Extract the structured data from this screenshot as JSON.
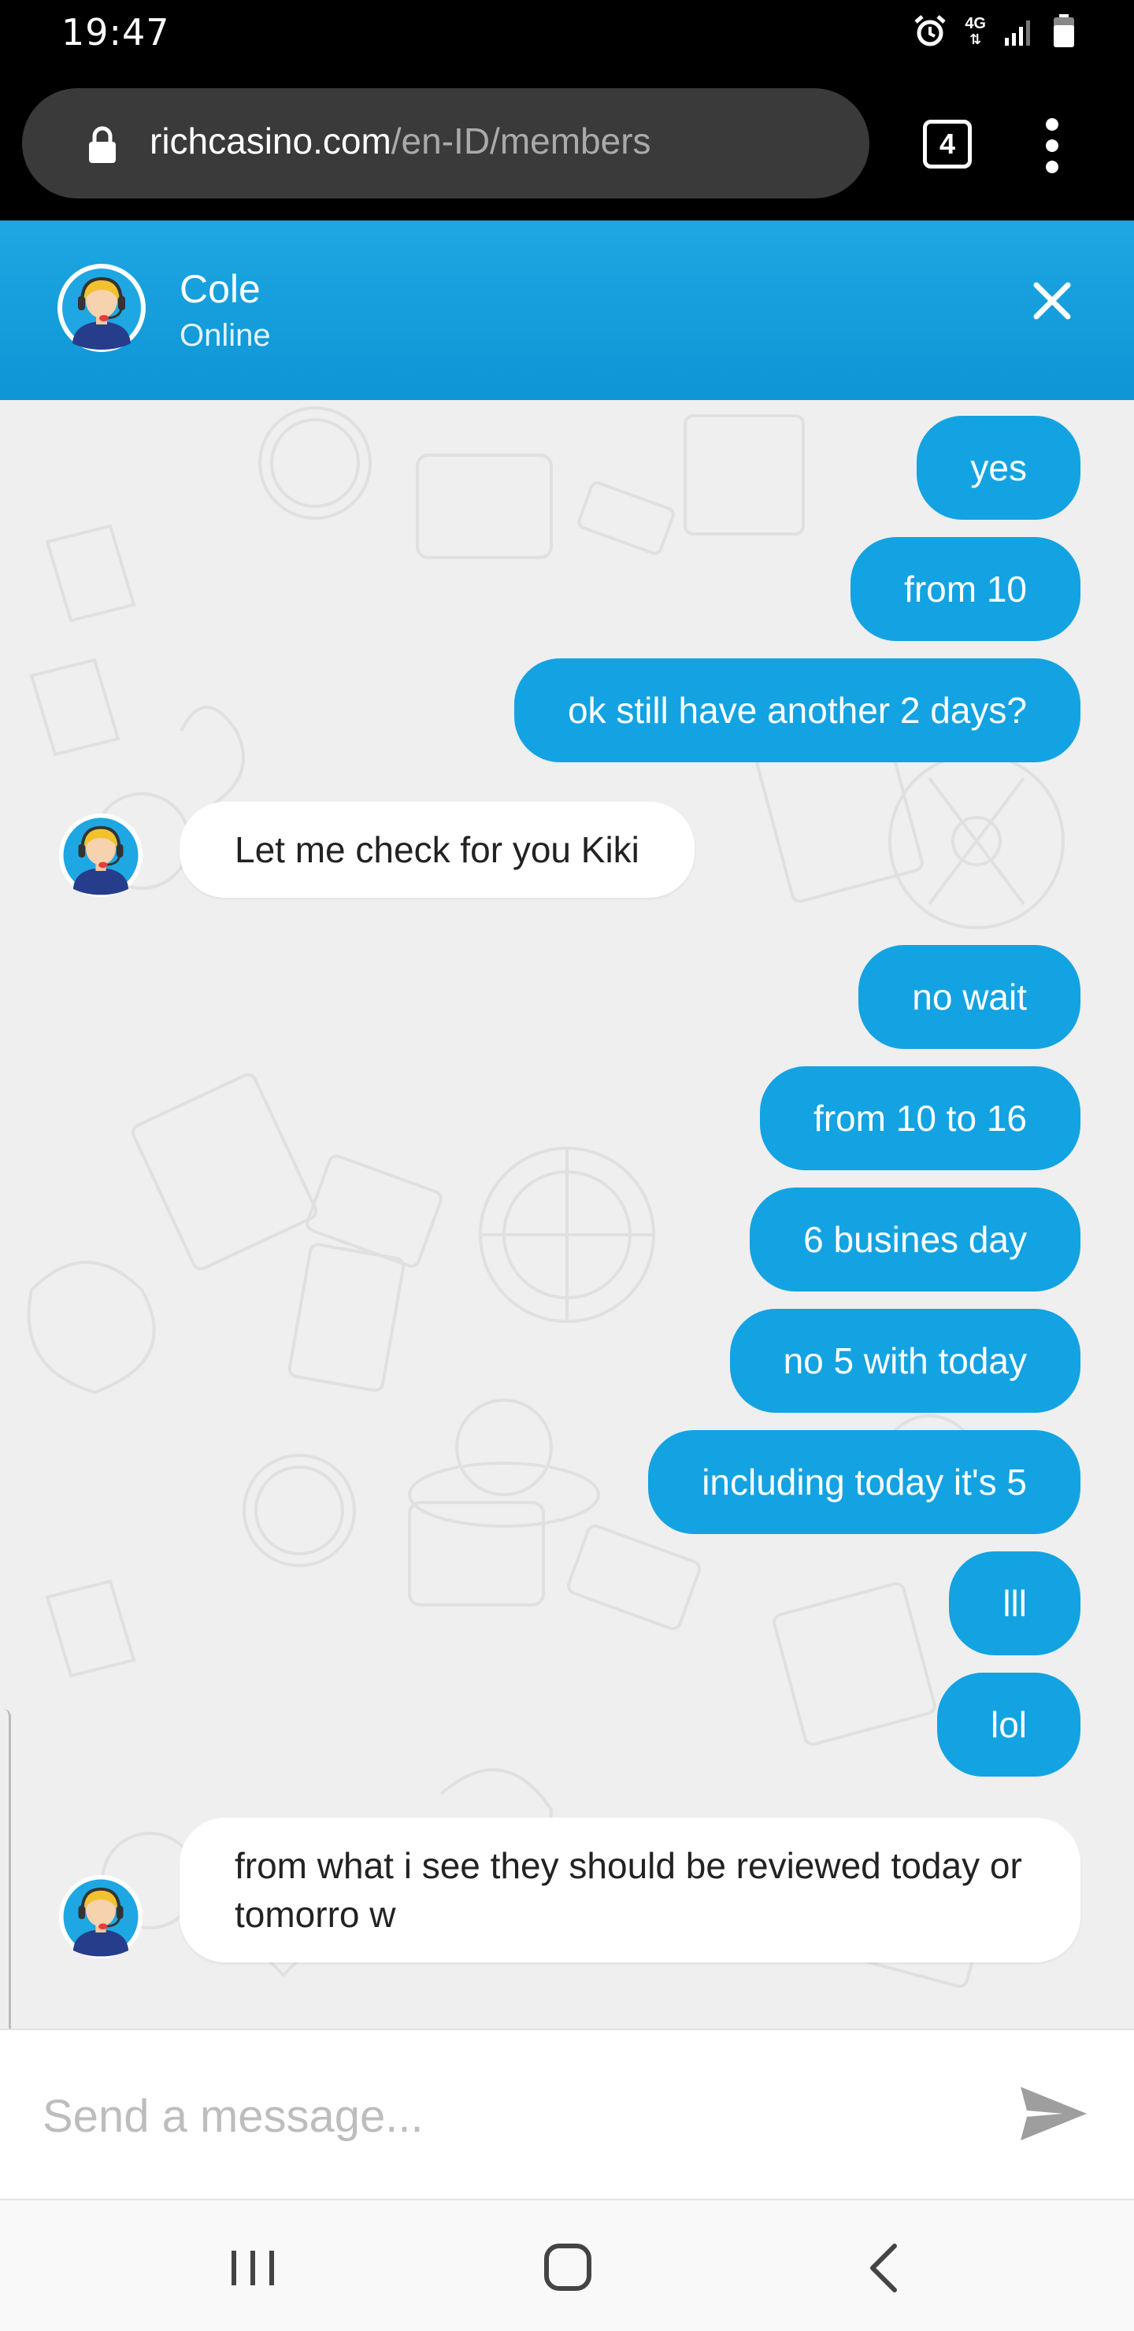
{
  "status_bar": {
    "time": "19:47",
    "network": "4G"
  },
  "browser": {
    "url_domain": "richcasino.com",
    "url_path": "/en-ID/members",
    "tab_count": "4"
  },
  "chat_header": {
    "agent_name": "Cole",
    "agent_status": "Online",
    "accent_color": "#13a3e2"
  },
  "messages": [
    {
      "from": "user",
      "text": "yes"
    },
    {
      "from": "user",
      "text": "from 10"
    },
    {
      "from": "user",
      "text": "ok still have another 2 days?"
    },
    {
      "from": "agent",
      "text": "Let me check for you Kiki"
    },
    {
      "from": "user",
      "text": "no wait"
    },
    {
      "from": "user",
      "text": "from 10 to 16"
    },
    {
      "from": "user",
      "text": "6 busines day"
    },
    {
      "from": "user",
      "text": "no 5 with today"
    },
    {
      "from": "user",
      "text": "including today it's 5"
    },
    {
      "from": "user",
      "text": "lll"
    },
    {
      "from": "user",
      "text": "lol"
    },
    {
      "from": "agent",
      "text": "from what i see they should be reviewed today or tomorro w"
    }
  ],
  "composer": {
    "placeholder": "Send a message..."
  },
  "icons": {
    "lock": "lock-icon",
    "more": "more-vert-icon",
    "close": "close-icon",
    "send": "send-icon",
    "alarm": "alarm-icon",
    "signal": "signal-icon",
    "battery": "battery-icon",
    "recents": "recents-icon",
    "home": "home-icon",
    "back": "back-icon"
  }
}
